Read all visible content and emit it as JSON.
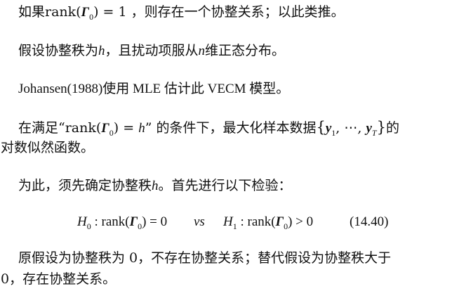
{
  "paragraphs": {
    "p1": {
      "before": "如果rank(",
      "gamma": "Γ",
      "gamma_sub": "0",
      "after": ") = 1 ，则存在一个协整关系；以此类推。"
    },
    "p2": {
      "before": "假设协整秩为",
      "var": "h",
      "after": "，且扰动项服从",
      "var2": "n",
      "after2": "维正态分布。"
    },
    "p3": {
      "text": "Johansen(1988)使用 MLE 估计此 VECM 模型。"
    },
    "p4": {
      "before": "在满足“rank(",
      "gamma": "Γ",
      "gamma_sub": "0",
      "mid": ") = ",
      "var": "h",
      "after": "” 的条件下，最大化样本数据",
      "brace_open": "{",
      "y1": "y",
      "y1_sub": "1",
      "ellipsis": ", ⋯, ",
      "yT": "y",
      "yT_sub": "T",
      "brace_close": "}",
      "end": "的",
      "line2": "对数似然函数。"
    },
    "p5": {
      "before": "为此，须先确定协整秩",
      "var": "h",
      "after": "。首先进行以下检验："
    },
    "equation": {
      "H0": "H",
      "H0_sub": "0",
      "left_mid": " : rank(",
      "gamma": "Γ",
      "gamma_sub": "0",
      "left_end": ") = 0",
      "vs": "vs",
      "H1": "H",
      "H1_sub": "1",
      "right_mid": " : rank(",
      "right_end": ") > 0",
      "number": "(14.40)"
    },
    "p6": {
      "line1": "原假设为协整秩为 0，不存在协整关系；替代假设为协整秩大于",
      "line2": "0，存在协整关系。"
    }
  }
}
